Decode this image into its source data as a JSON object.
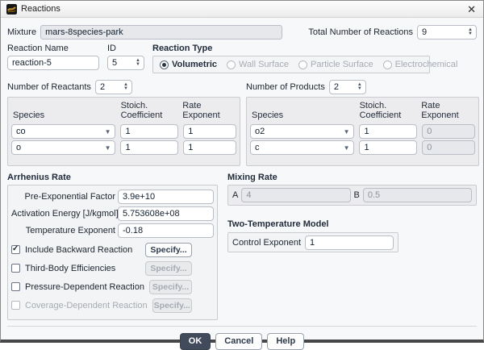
{
  "window": {
    "title": "Reactions",
    "close_glyph": "✕"
  },
  "header": {
    "mixture_label": "Mixture",
    "mixture_value": "mars-8species-park",
    "total_reactions_label": "Total Number of Reactions",
    "total_reactions_value": "9"
  },
  "reaction": {
    "name_label": "Reaction Name",
    "name_value": "reaction-5",
    "id_label": "ID",
    "id_value": "5",
    "type_label": "Reaction Type",
    "types": [
      {
        "label": "Volumetric",
        "selected": true,
        "enabled": true
      },
      {
        "label": "Wall Surface",
        "selected": false,
        "enabled": false
      },
      {
        "label": "Particle Surface",
        "selected": false,
        "enabled": false
      },
      {
        "label": "Electrochemical",
        "selected": false,
        "enabled": false
      }
    ]
  },
  "reactants": {
    "count_label": "Number of Reactants",
    "count_value": "2",
    "col_species": "Species",
    "col_coeff": "Stoich. Coefficient",
    "col_rate": "Rate Exponent",
    "rows": [
      {
        "species": "co",
        "coeff": "1",
        "rate": "1"
      },
      {
        "species": "o",
        "coeff": "1",
        "rate": "1"
      }
    ]
  },
  "products": {
    "count_label": "Number of Products",
    "count_value": "2",
    "col_species": "Species",
    "col_coeff": "Stoich. Coefficient",
    "col_rate": "Rate Exponent",
    "rows": [
      {
        "species": "o2",
        "coeff": "1",
        "rate": "0",
        "rate_disabled": true
      },
      {
        "species": "c",
        "coeff": "1",
        "rate": "0",
        "rate_disabled": true
      }
    ]
  },
  "arrhenius": {
    "title": "Arrhenius Rate",
    "fields": [
      {
        "label": "Pre-Exponential Factor",
        "value": "3.9e+10"
      },
      {
        "label": "Activation Energy [J/kgmol]",
        "value": "5.753608e+08"
      },
      {
        "label": "Temperature Exponent",
        "value": "-0.18"
      }
    ],
    "options": [
      {
        "label": "Include Backward Reaction",
        "checked": true,
        "enabled": true,
        "button": "Specify...",
        "button_enabled": true
      },
      {
        "label": "Third-Body Efficiencies",
        "checked": false,
        "enabled": true,
        "button": "Specify...",
        "button_enabled": false
      },
      {
        "label": "Pressure-Dependent Reaction",
        "checked": false,
        "enabled": true,
        "button": "Specify...",
        "button_enabled": false
      },
      {
        "label": "Coverage-Dependent Reaction",
        "checked": false,
        "enabled": false,
        "button": "Specify...",
        "button_enabled": false
      }
    ]
  },
  "mixing_rate": {
    "title": "Mixing Rate",
    "a_label": "A",
    "a_value": "4",
    "b_label": "B",
    "b_value": "0.5"
  },
  "two_temperature": {
    "title": "Two-Temperature Model",
    "control_label": "Control Exponent",
    "control_value": "1"
  },
  "footer": {
    "ok": "OK",
    "cancel": "Cancel",
    "help": "Help"
  },
  "colors": {
    "primary_button": "#414b5c",
    "disabled_text": "#a6abb3",
    "groupbox_bg": "#ececee"
  }
}
